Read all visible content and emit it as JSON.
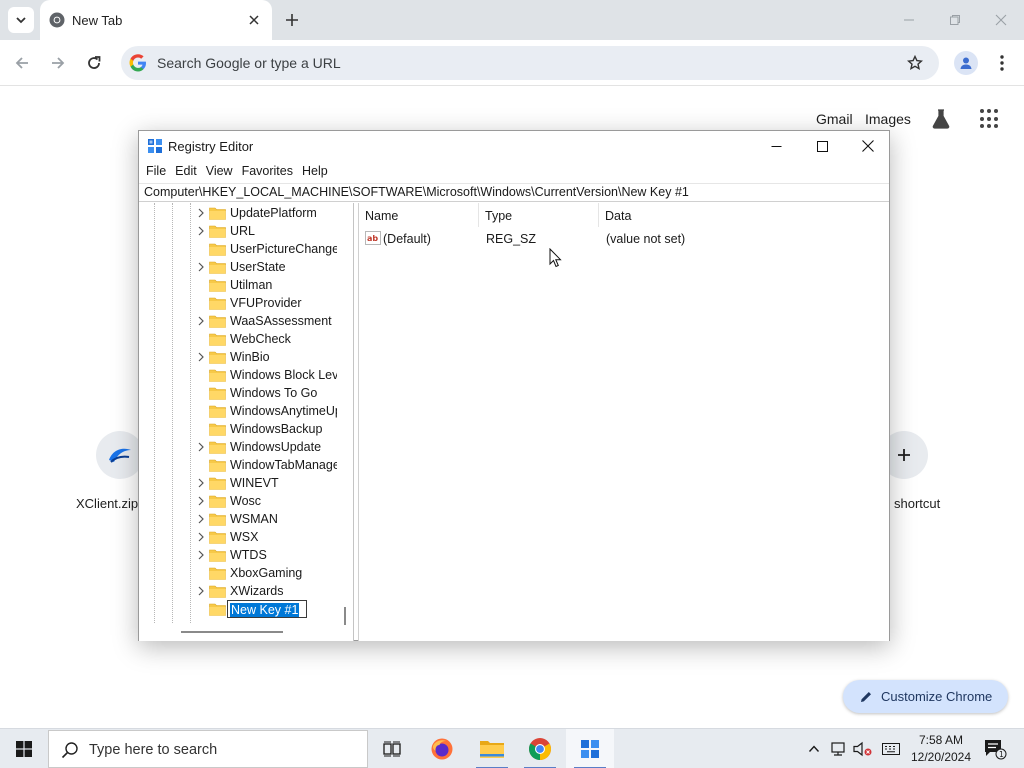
{
  "browser": {
    "tab_title": "New Tab",
    "omnibox_placeholder": "Search Google or type a URL"
  },
  "ntp": {
    "links": [
      "Gmail",
      "Images"
    ],
    "shortcuts": [
      {
        "label": "XClient.zip"
      },
      {
        "label": "shortcut"
      }
    ],
    "customize_label": "Customize Chrome"
  },
  "regedit": {
    "title": "Registry Editor",
    "menu": [
      "File",
      "Edit",
      "View",
      "Favorites",
      "Help"
    ],
    "address": "Computer\\HKEY_LOCAL_MACHINE\\SOFTWARE\\Microsoft\\Windows\\CurrentVersion\\New Key #1",
    "tree": [
      {
        "label": "UpdatePlatform",
        "expandable": true
      },
      {
        "label": "URL",
        "expandable": true
      },
      {
        "label": "UserPictureChange",
        "expandable": false
      },
      {
        "label": "UserState",
        "expandable": true
      },
      {
        "label": "Utilman",
        "expandable": false
      },
      {
        "label": "VFUProvider",
        "expandable": false
      },
      {
        "label": "WaaSAssessment",
        "expandable": true
      },
      {
        "label": "WebCheck",
        "expandable": false
      },
      {
        "label": "WinBio",
        "expandable": true
      },
      {
        "label": "Windows Block Level",
        "expandable": false
      },
      {
        "label": "Windows To Go",
        "expandable": false
      },
      {
        "label": "WindowsAnytimeUpgrade",
        "expandable": false
      },
      {
        "label": "WindowsBackup",
        "expandable": false
      },
      {
        "label": "WindowsUpdate",
        "expandable": true
      },
      {
        "label": "WindowTabManager",
        "expandable": false
      },
      {
        "label": "WINEVT",
        "expandable": true
      },
      {
        "label": "Wosc",
        "expandable": true
      },
      {
        "label": "WSMAN",
        "expandable": true
      },
      {
        "label": "WSX",
        "expandable": true
      },
      {
        "label": "WTDS",
        "expandable": true
      },
      {
        "label": "XboxGaming",
        "expandable": false
      },
      {
        "label": "XWizards",
        "expandable": true
      }
    ],
    "editing_key": "New Key #1",
    "columns": [
      "Name",
      "Type",
      "Data"
    ],
    "values": [
      {
        "name": "(Default)",
        "type": "REG_SZ",
        "data": "(value not set)"
      }
    ]
  },
  "taskbar": {
    "search_placeholder": "Type here to search",
    "time": "7:58 AM",
    "date": "12/20/2024",
    "notification_count": "1"
  }
}
